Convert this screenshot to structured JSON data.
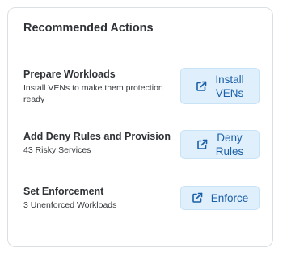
{
  "card": {
    "title": "Recommended Actions"
  },
  "actions": [
    {
      "title": "Prepare Workloads",
      "subtitle": "Install VENs to make them protection ready",
      "button_label": "Install\nVENs",
      "button_icon": "external-link-icon"
    },
    {
      "title": "Add Deny Rules and Provision",
      "subtitle": "43 Risky Services",
      "button_label": "Deny\nRules",
      "button_icon": "external-link-icon"
    },
    {
      "title": "Set Enforcement",
      "subtitle": "3 Unenforced Workloads",
      "button_label": "Enforce",
      "button_icon": "external-link-icon"
    }
  ],
  "colors": {
    "button_bg": "#dfeffb",
    "button_text": "#1a5fa8",
    "card_border": "#dcdfe3",
    "title_text": "#2f3236"
  }
}
